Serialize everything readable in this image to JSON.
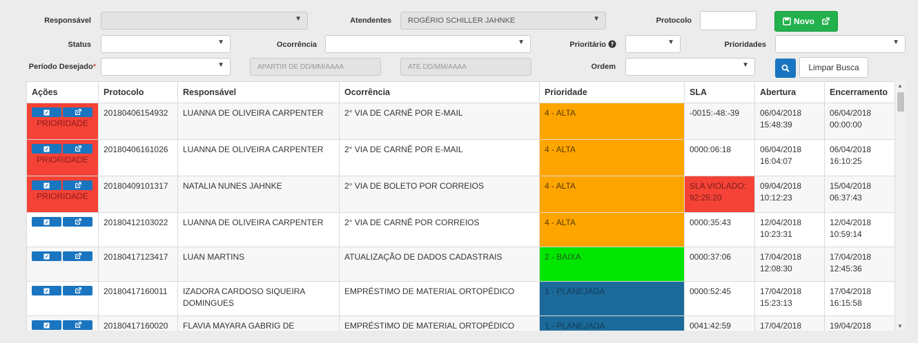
{
  "filters": {
    "responsavel_label": "Responsável",
    "atendentes_label": "Atendentes",
    "atendentes_value": "ROGÉRIO SCHILLER JAHNKE",
    "protocolo_label": "Protocolo",
    "status_label": "Status",
    "ocorrencia_label": "Ocorrência",
    "prioritario_label": "Prioritário",
    "prioridades_label": "Prioridades",
    "periodo_label": "Período Desejado",
    "periodo_req": "*",
    "apartir_placeholder": "APARTIR DE DD/MM/AAAA",
    "ate_placeholder": "ATÉ DD/MM/AAAA",
    "ordem_label": "Ordem"
  },
  "buttons": {
    "novo_label": "Novo",
    "limpar_label": "Limpar Busca"
  },
  "table": {
    "headers": [
      "Ações",
      "Protocolo",
      "Responsável",
      "Ocorrência",
      "Prioridade",
      "SLA",
      "Abertura",
      "Encerramento"
    ],
    "priority_label": "PRIORIDADE",
    "rows": [
      {
        "protocolo": "20180406154932",
        "responsavel": "LUANNA DE OLIVEIRA CARPENTER",
        "ocorrencia": "2° VIA DE CARNÊ POR E-MAIL",
        "prioridade": "4 - ALTA",
        "sla": "-0015:-48:-39",
        "abertura": "06/04/2018 15:48:39",
        "encerramento": "06/04/2018 00:00:00"
      },
      {
        "protocolo": "20180406161026",
        "responsavel": "LUANNA DE OLIVEIRA CARPENTER",
        "ocorrencia": "2° VIA DE CARNÊ POR E-MAIL",
        "prioridade": "4 - ALTA",
        "sla": "0000:06:18",
        "abertura": "06/04/2018 16:04:07",
        "encerramento": "06/04/2018 16:10:25"
      },
      {
        "protocolo": "20180409101317",
        "responsavel": "NATALIA NUNES JAHNKE",
        "ocorrencia": "2° VIA DE BOLETO POR CORREIOS",
        "prioridade": "4 - ALTA",
        "sla": "SLA VIOLADO: 92:25:20",
        "abertura": "09/04/2018 10:12:23",
        "encerramento": "15/04/2018 06:37:43"
      },
      {
        "protocolo": "20180412103022",
        "responsavel": "LUANNA DE OLIVEIRA CARPENTER",
        "ocorrencia": "2° VIA DE CARNÊ POR CORREIOS",
        "prioridade": "4 - ALTA",
        "sla": "0000:35:43",
        "abertura": "12/04/2018 10:23:31",
        "encerramento": "12/04/2018 10:59:14"
      },
      {
        "protocolo": "20180417123417",
        "responsavel": "LUAN MARTINS",
        "ocorrencia": "ATUALIZAÇÃO DE DADOS CADASTRAIS",
        "prioridade": "2 - BAIXA",
        "sla": "0000:37:06",
        "abertura": "17/04/2018 12:08:30",
        "encerramento": "17/04/2018 12:45:36"
      },
      {
        "protocolo": "20180417160011",
        "responsavel": "IZADORA CARDOSO SIQUEIRA DOMINGUES",
        "ocorrencia": "EMPRÉSTIMO DE MATERIAL ORTOPÉDICO",
        "prioridade": "1 - PLANEJADA",
        "sla": "0000:52:45",
        "abertura": "17/04/2018 15:23:13",
        "encerramento": "17/04/2018 16:15:58"
      },
      {
        "protocolo": "20180417160020",
        "responsavel": "FLAVIA MAYARA GABRIG DE",
        "ocorrencia": "EMPRÉSTIMO DE MATERIAL ORTOPÉDICO",
        "prioridade": "1 - PLANEJADA",
        "sla": "0041:42:59",
        "abertura": "17/04/2018",
        "encerramento": "19/04/2018"
      }
    ]
  },
  "colors": {
    "alta": "#ffa500",
    "baixa": "#00e600",
    "planejada": "#1c6a99",
    "violado": "#f44336",
    "primary": "#1a75c0",
    "novo": "#22b14c"
  }
}
